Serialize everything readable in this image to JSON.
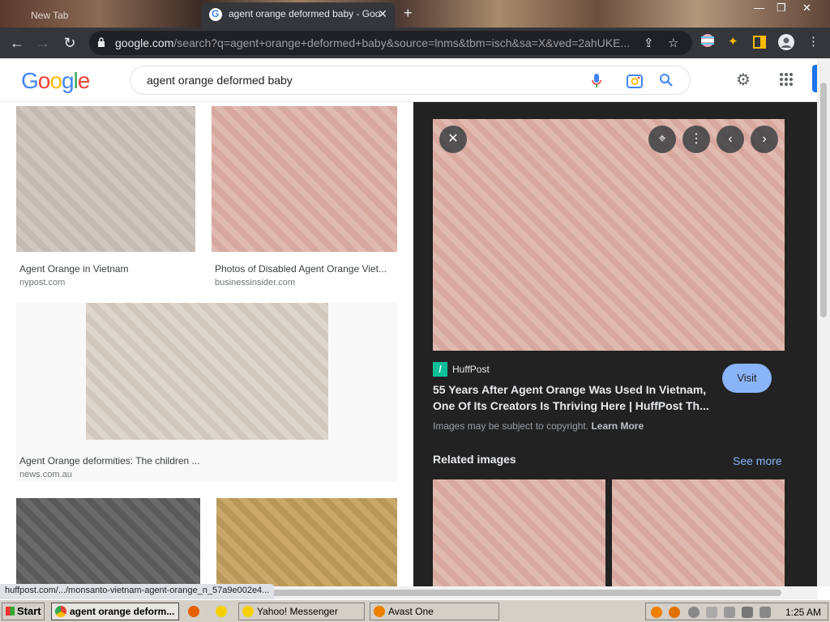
{
  "browser": {
    "inactive_tab_label": "New Tab",
    "active_tab_label": "agent orange deformed baby - Goo",
    "url_host": "google.com",
    "url_rest": "/search?q=agent+orange+deformed+baby&source=lnms&tbm=isch&sa=X&ved=2ahUKE...",
    "status_link": "huffpost.com/.../monsanto-vietnam-agent-orange_n_57a9e002e4..."
  },
  "google": {
    "logo_text": "Google",
    "query": "agent orange deformed baby"
  },
  "results": [
    {
      "caption": "Agent Orange in Vietnam",
      "source": "nypost.com"
    },
    {
      "caption": "Photos of Disabled Agent Orange Viet...",
      "source": "businessinsider.com"
    },
    {
      "caption": "Agent Orange deformities: The children ...",
      "source": "news.com.au"
    },
    {
      "caption": "",
      "source": ""
    },
    {
      "caption": "",
      "source": ""
    }
  ],
  "preview": {
    "source_name": "HuffPost",
    "title": "55 Years After Agent Orange Was Used In Vietnam, One Of Its Creators Is Thriving Here | HuffPost Th...",
    "visit_label": "Visit",
    "copyright_text": "Images may be subject to copyright.",
    "learn_more": "Learn More",
    "related_heading": "Related images",
    "see_more": "See more"
  },
  "taskbar": {
    "start_label": "Start",
    "tasks": [
      "agent orange deform...",
      "Yahoo! Messenger",
      "Avast One"
    ],
    "clock": "1:25 AM"
  },
  "colors": {
    "accent_blue": "#1a73e8",
    "visit_button": "#8ab4f8",
    "preview_bg": "#222222"
  }
}
